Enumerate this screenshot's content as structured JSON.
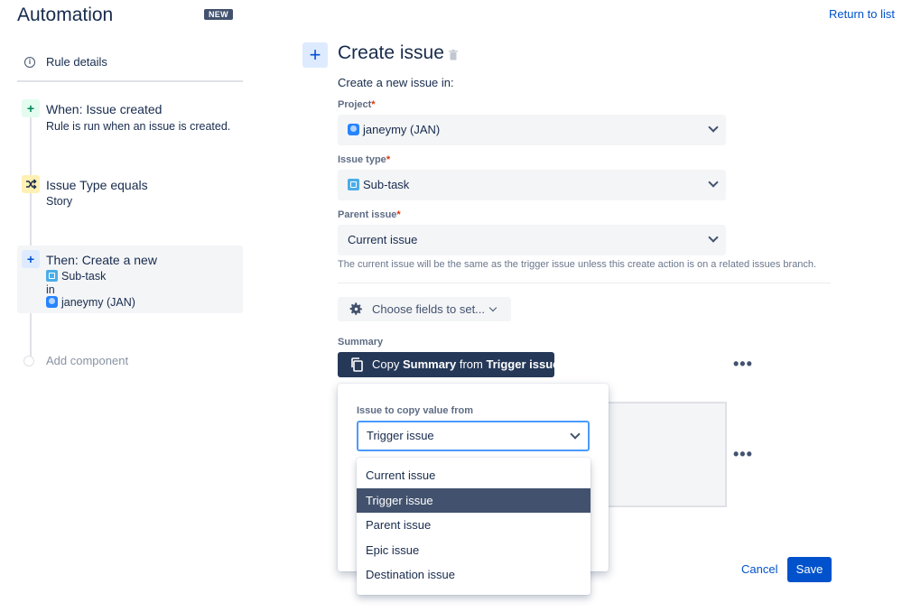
{
  "header": {
    "app_title": "Automation",
    "badge": "NEW",
    "return_link": "Return to list"
  },
  "sidebar": {
    "rule_details": "Rule details",
    "steps": [
      {
        "icon": "plus-icon",
        "title": "When: Issue created",
        "subtitle": "Rule is run when an issue is created.",
        "color": "#e3fcef"
      },
      {
        "icon": "shuffle-icon",
        "title": "Issue Type equals",
        "subtitle": "Story",
        "color": "#fff0b3"
      },
      {
        "icon": "plus-icon",
        "title": "Then: Create a new",
        "line1": "Sub-task",
        "line2": "in",
        "line3": "janeymy (JAN)",
        "color": "#deebff"
      }
    ],
    "add_component": "Add component"
  },
  "main": {
    "title": "Create issue",
    "lead": "Create a new issue in:",
    "project": {
      "label": "Project",
      "value": "janeymy (JAN)"
    },
    "issue_type": {
      "label": "Issue type",
      "value": "Sub-task"
    },
    "parent_issue": {
      "label": "Parent issue",
      "value": "Current issue"
    },
    "help_text": "The current issue will be the same as the trigger issue unless this create action is on a related issues branch.",
    "choose_fields": "Choose fields to set...",
    "summary_label": "Summary",
    "copy_button": {
      "prefix": "Copy ",
      "field": "Summary",
      "mid": " from ",
      "source": "Trigger issue"
    },
    "required_mark": "*",
    "cancel": "Cancel",
    "save": "Save"
  },
  "popup": {
    "label": "Issue to copy value from",
    "selected": "Trigger issue",
    "options": [
      "Current issue",
      "Trigger issue",
      "Parent issue",
      "Epic issue",
      "Destination issue"
    ],
    "highlighted_index": 1
  },
  "colors": {
    "primary": "#0052cc",
    "dark_button": "#253858",
    "highlight": "#42526e"
  }
}
